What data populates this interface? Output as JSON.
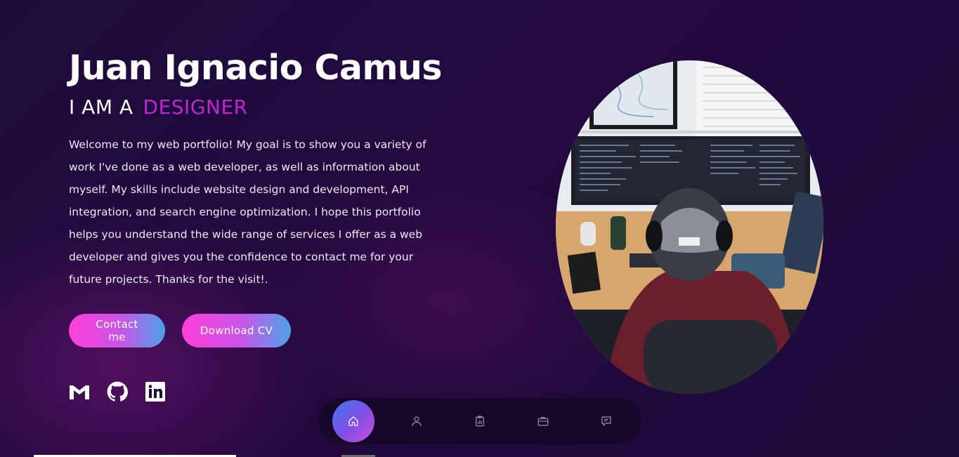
{
  "hero": {
    "name": "Juan Ignacio Camus",
    "role_prefix": "I AM A",
    "role_word": "DESIGNER",
    "intro": "Welcome to my web portfolio! My goal is to show you a variety of work I've done as a web developer, as well as information about myself. My skills include website design and development, API integration, and search engine optimization. I hope this portfolio helps you understand the wide range of services I offer as a web developer and gives you the confidence to contact me for your future projects. Thanks for the visit!."
  },
  "buttons": {
    "contact_label": "Contact me",
    "download_label": "Download CV"
  },
  "socials": [
    {
      "icon": "gmail-icon"
    },
    {
      "icon": "github-icon"
    },
    {
      "icon": "linkedin-icon"
    }
  ],
  "photo": {
    "alt": ""
  },
  "dock": {
    "items": [
      {
        "icon": "home-icon",
        "active": true
      },
      {
        "icon": "user-icon",
        "active": false
      },
      {
        "icon": "clipboard-icon",
        "active": false
      },
      {
        "icon": "briefcase-icon",
        "active": false
      },
      {
        "icon": "message-icon",
        "active": false
      }
    ]
  },
  "colors": {
    "accent": "#c027d0",
    "button_gradient_start": "#ff3fd8",
    "button_gradient_end": "#4aa3e8",
    "background": "#1d0c3b"
  }
}
